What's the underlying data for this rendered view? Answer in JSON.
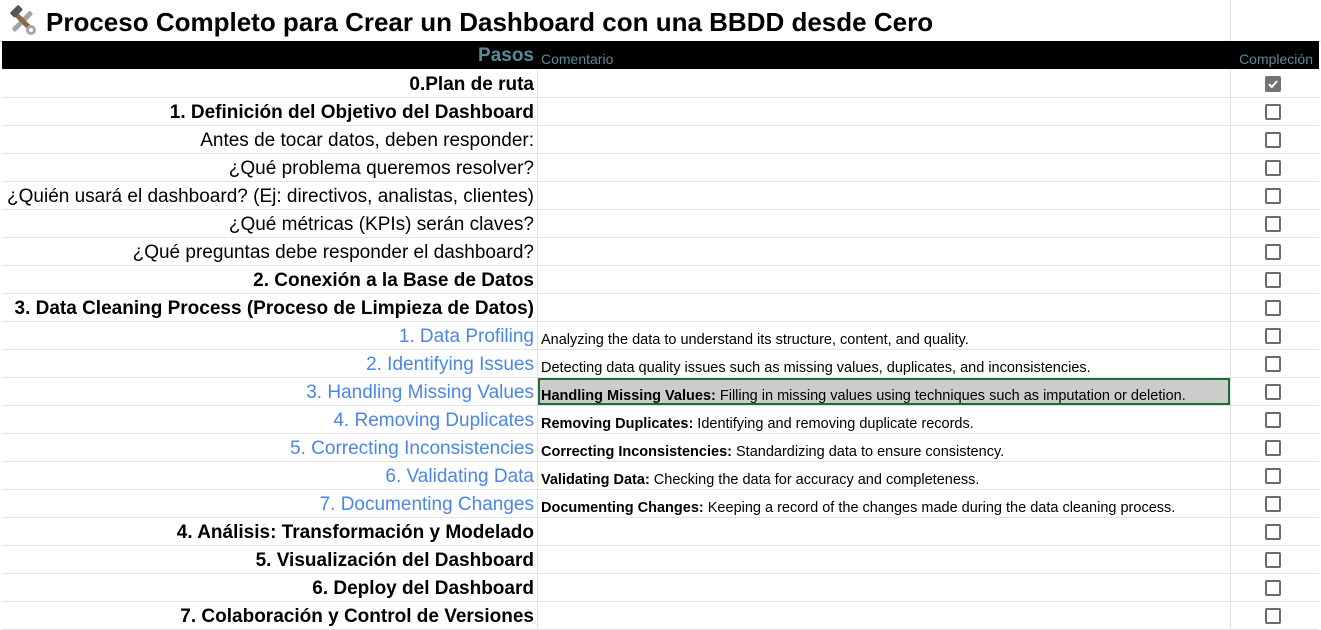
{
  "sheet": {
    "title": "Proceso Completo para Crear un Dashboard con una BBDD desde Cero",
    "title_icon": "hammer-and-wrench-icon",
    "headers": {
      "steps": "Pasos",
      "comment": "Comentario",
      "completion": "Compleción"
    },
    "rows": [
      {
        "step": "0.Plan de ruta",
        "style": "bold",
        "comment_label": "",
        "comment_text": "",
        "checked": true
      },
      {
        "step": "1. Definición del Objetivo del Dashboard",
        "style": "bold",
        "comment_label": "",
        "comment_text": "",
        "checked": false
      },
      {
        "step": "Antes de tocar datos, deben responder:",
        "style": "normal",
        "comment_label": "",
        "comment_text": "",
        "checked": false
      },
      {
        "step": "¿Qué problema queremos resolver?",
        "style": "normal",
        "comment_label": "",
        "comment_text": "",
        "checked": false
      },
      {
        "step": "¿Quién usará el dashboard? (Ej: directivos, analistas, clientes)",
        "style": "normal",
        "comment_label": "",
        "comment_text": "",
        "checked": false
      },
      {
        "step": "¿Qué métricas (KPIs) serán claves?",
        "style": "normal",
        "comment_label": "",
        "comment_text": "",
        "checked": false
      },
      {
        "step": "¿Qué preguntas debe responder el dashboard?",
        "style": "normal",
        "comment_label": "",
        "comment_text": "",
        "checked": false
      },
      {
        "step": "2. Conexión a la Base de Datos",
        "style": "bold",
        "comment_label": "",
        "comment_text": "",
        "checked": false
      },
      {
        "step": "3. Data Cleaning Process (Proceso de Limpieza de Datos)",
        "style": "bold",
        "comment_label": "",
        "comment_text": "",
        "checked": false
      },
      {
        "step": "1. Data Profiling",
        "style": "sub",
        "comment_label": "",
        "comment_text": "Analyzing the data to understand its structure, content, and quality.",
        "checked": false
      },
      {
        "step": "2. Identifying Issues",
        "style": "sub",
        "comment_label": "",
        "comment_text": "Detecting data quality issues such as missing values, duplicates, and inconsistencies.",
        "checked": false
      },
      {
        "step": "3. Handling Missing Values",
        "style": "sub",
        "comment_label": "Handling Missing Values:",
        "comment_text": " Filling in missing values using techniques such as imputation or deletion.",
        "checked": false,
        "selected": true
      },
      {
        "step": "4. Removing Duplicates",
        "style": "sub",
        "comment_label": "Removing Duplicates:",
        "comment_text": " Identifying and removing duplicate records.",
        "checked": false
      },
      {
        "step": "5. Correcting Inconsistencies",
        "style": "sub",
        "comment_label": "Correcting Inconsistencies:",
        "comment_text": " Standardizing data to ensure consistency.",
        "checked": false
      },
      {
        "step": "6. Validating Data",
        "style": "sub",
        "comment_label": "Validating Data:",
        "comment_text": " Checking the data for accuracy and completeness.",
        "checked": false
      },
      {
        "step": "7. Documenting Changes",
        "style": "sub",
        "comment_label": "Documenting Changes:",
        "comment_text": " Keeping a record of the changes made during the data cleaning process.",
        "checked": false
      },
      {
        "step": "4. Análisis: Transformación y Modelado",
        "style": "bold",
        "comment_label": "",
        "comment_text": "",
        "checked": false
      },
      {
        "step": "5. Visualización del Dashboard",
        "style": "bold",
        "comment_label": "",
        "comment_text": "",
        "checked": false
      },
      {
        "step": "6. Deploy del Dashboard",
        "style": "bold",
        "comment_label": "",
        "comment_text": "",
        "checked": false
      },
      {
        "step": "7. Colaboración y Control de Versiones",
        "style": "bold",
        "comment_label": "",
        "comment_text": "",
        "checked": false
      }
    ]
  },
  "colors": {
    "header_bg": "#000000",
    "header_text": "#5b8a96",
    "substep_text": "#4a86e8",
    "selected_bg": "#cccccc",
    "selected_border": "#1e6b3a",
    "checkbox": "#6b6b6b"
  }
}
